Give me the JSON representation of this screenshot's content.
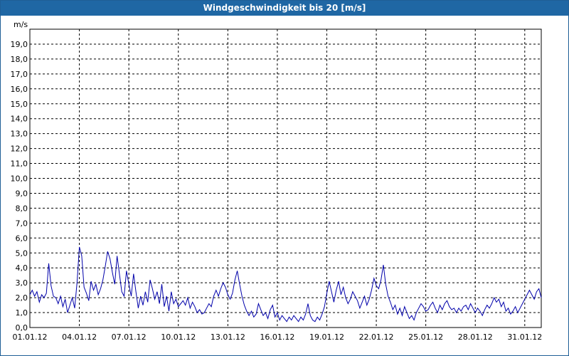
{
  "window": {
    "title": "Windgeschwindigkeit bis 20 [m/s]"
  },
  "colors": {
    "titlebar": "#1f67a4",
    "series": "#0000aa",
    "grid": "#000000"
  },
  "chart_data": {
    "type": "line",
    "title": "Windgeschwindigkeit bis 20 [m/s]",
    "ylabel": "m/s",
    "xlabel": "",
    "ylim": [
      0,
      20
    ],
    "xlim_days": [
      1,
      32
    ],
    "y_ticks": [
      "0,0",
      "1,0",
      "2,0",
      "3,0",
      "4,0",
      "5,0",
      "6,0",
      "7,0",
      "8,0",
      "9,0",
      "10,0",
      "11,0",
      "12,0",
      "13,0",
      "14,0",
      "15,0",
      "16,0",
      "17,0",
      "18,0",
      "19,0"
    ],
    "x_ticks": [
      "01.01.12",
      "04.01.12",
      "07.01.12",
      "10.01.12",
      "13.01.12",
      "16.01.12",
      "19.01.12",
      "22.01.12",
      "25.01.12",
      "28.01.12",
      "31.01.12"
    ],
    "grid": true,
    "series": [
      {
        "x_start": "01.01.12",
        "x_end": "01.02.12",
        "values": [
          2.2,
          2.5,
          2.1,
          2.4,
          1.7,
          2.2,
          2.0,
          2.3,
          4.3,
          2.8,
          2.1,
          2.0,
          1.6,
          2.1,
          1.4,
          1.9,
          1.0,
          1.5,
          2.0,
          1.3,
          3.0,
          5.4,
          4.8,
          2.7,
          2.3,
          1.8,
          3.1,
          2.5,
          2.9,
          2.2,
          2.6,
          3.2,
          4.1,
          5.1,
          4.6,
          3.7,
          2.9,
          4.8,
          3.6,
          2.4,
          2.1,
          3.8,
          2.9,
          2.1,
          3.6,
          2.4,
          1.3,
          2.1,
          1.5,
          2.4,
          1.7,
          3.2,
          2.6,
          1.9,
          2.4,
          1.6,
          2.9,
          1.4,
          2.1,
          1.1,
          2.4,
          1.6,
          1.9,
          1.4,
          1.6,
          1.8,
          1.5,
          2.0,
          1.3,
          1.7,
          1.4,
          1.0,
          1.2,
          0.9,
          1.0,
          1.3,
          1.6,
          1.4,
          2.1,
          2.5,
          2.1,
          2.6,
          3.0,
          2.7,
          2.2,
          1.9,
          2.3,
          3.2,
          3.8,
          2.9,
          2.1,
          1.5,
          1.1,
          0.8,
          1.1,
          0.7,
          0.9,
          1.6,
          1.2,
          0.8,
          1.0,
          0.6,
          1.2,
          1.5,
          0.7,
          1.0,
          0.5,
          0.8,
          0.6,
          0.4,
          0.7,
          0.5,
          0.8,
          0.6,
          0.4,
          0.7,
          0.5,
          0.9,
          1.6,
          0.8,
          0.5,
          0.4,
          0.7,
          0.5,
          0.9,
          1.4,
          2.3,
          3.1,
          2.4,
          1.7,
          2.5,
          3.1,
          2.2,
          2.7,
          2.0,
          1.6,
          1.9,
          2.4,
          2.1,
          1.8,
          1.3,
          1.7,
          2.1,
          1.5,
          1.9,
          2.5,
          3.3,
          2.8,
          2.6,
          3.2,
          4.2,
          2.9,
          2.1,
          1.7,
          1.2,
          1.5,
          0.9,
          1.3,
          0.8,
          1.4,
          1.0,
          0.6,
          0.8,
          0.5,
          1.0,
          1.3,
          1.6,
          1.4,
          1.1,
          1.2,
          1.5,
          1.7,
          1.3,
          1.0,
          1.5,
          1.2,
          1.6,
          1.8,
          1.4,
          1.2,
          1.3,
          1.0,
          1.3,
          1.1,
          1.4,
          1.5,
          1.2,
          1.6,
          1.3,
          1.0,
          1.3,
          1.1,
          0.8,
          1.2,
          1.5,
          1.3,
          1.6,
          2.0,
          1.7,
          1.9,
          1.4,
          1.7,
          1.1,
          1.3,
          0.9,
          1.1,
          1.4,
          1.0,
          1.3,
          1.6,
          1.9,
          2.2,
          2.5,
          2.2,
          1.9,
          2.4,
          2.6,
          2.0
        ]
      }
    ]
  }
}
